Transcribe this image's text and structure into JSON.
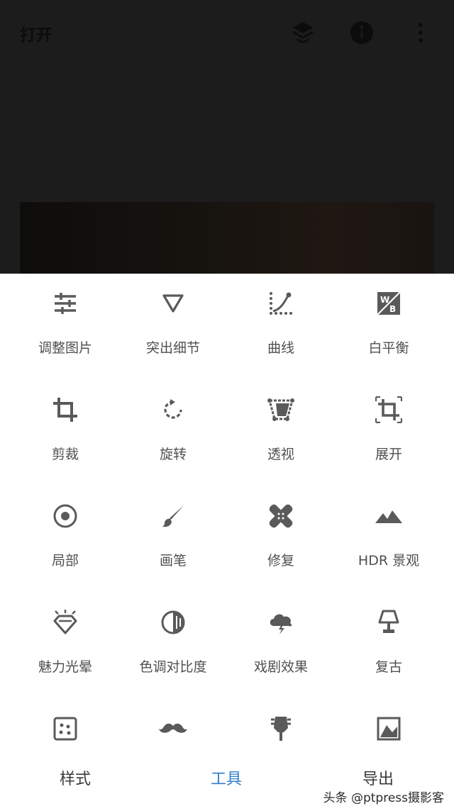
{
  "header": {
    "open_label": "打开"
  },
  "icons": {
    "layers": "layers-rotate-icon",
    "info": "info-icon",
    "more": "more-vertical-icon"
  },
  "tools": [
    {
      "label": "调整图片",
      "icon": "tune-sliders-icon"
    },
    {
      "label": "突出细节",
      "icon": "details-triangle-icon"
    },
    {
      "label": "曲线",
      "icon": "curves-icon"
    },
    {
      "label": "白平衡",
      "icon": "white-balance-icon"
    },
    {
      "label": "剪裁",
      "icon": "crop-icon"
    },
    {
      "label": "旋转",
      "icon": "rotate-icon"
    },
    {
      "label": "透视",
      "icon": "perspective-icon"
    },
    {
      "label": "展开",
      "icon": "expand-icon"
    },
    {
      "label": "局部",
      "icon": "selective-icon"
    },
    {
      "label": "画笔",
      "icon": "brush-icon"
    },
    {
      "label": "修复",
      "icon": "healing-icon"
    },
    {
      "label": "HDR 景观",
      "icon": "hdr-mountain-icon"
    },
    {
      "label": "魅力光晕",
      "icon": "glamour-glow-icon"
    },
    {
      "label": "色调对比度",
      "icon": "tonal-contrast-icon"
    },
    {
      "label": "戏剧效果",
      "icon": "drama-cloud-icon"
    },
    {
      "label": "复古",
      "icon": "vintage-lamp-icon"
    },
    {
      "label": "",
      "icon": "grainy-film-icon"
    },
    {
      "label": "",
      "icon": "retrolux-mustache-icon"
    },
    {
      "label": "",
      "icon": "grunge-guitar-icon"
    },
    {
      "label": "",
      "icon": "black-white-icon"
    }
  ],
  "tabs": {
    "styles": "样式",
    "tools": "工具",
    "export": "导出"
  },
  "watermark": "头条 @ptpress摄影客",
  "colors": {
    "accent": "#2e7fc9",
    "icon": "#5a5a5a",
    "label": "#505050"
  }
}
